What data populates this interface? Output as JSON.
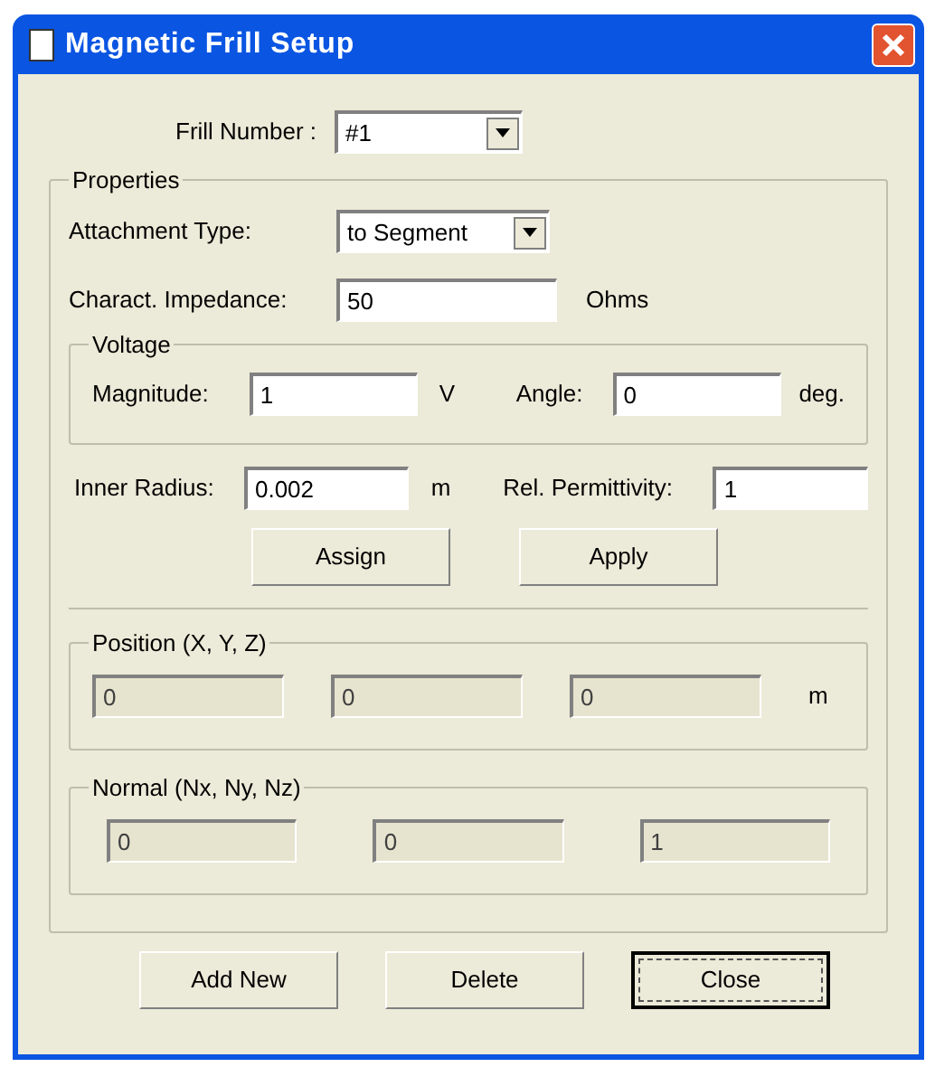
{
  "window": {
    "title": "Magnetic Frill Setup"
  },
  "frill_number": {
    "label": "Frill Number :",
    "value": "#1"
  },
  "properties": {
    "title": "Properties",
    "attachment_type": {
      "label": "Attachment Type:",
      "value": "to Segment"
    },
    "impedance": {
      "label": "Charact. Impedance:",
      "value": "50",
      "unit": "Ohms"
    },
    "voltage": {
      "title": "Voltage",
      "magnitude": {
        "label": "Magnitude:",
        "value": "1",
        "unit": "V"
      },
      "angle": {
        "label": "Angle:",
        "value": "0",
        "unit": "deg."
      }
    },
    "inner_radius": {
      "label": "Inner Radius:",
      "value": "0.002",
      "unit": "m"
    },
    "permittivity": {
      "label": "Rel. Permittivity:",
      "value": "1"
    },
    "buttons": [
      {
        "label": "Assign"
      },
      {
        "label": "Apply"
      }
    ],
    "position": {
      "title": "Position (X, Y, Z)",
      "disabled": true,
      "values": [
        "0",
        "0",
        "0"
      ],
      "unit": "m"
    },
    "normal": {
      "title": "Normal (Nx, Ny, Nz)",
      "disabled": true,
      "values": [
        "0",
        "0",
        "1"
      ]
    }
  },
  "buttons": [
    {
      "label": "Add New",
      "default": false
    },
    {
      "label": "Delete",
      "default": false
    },
    {
      "label": "Close",
      "default": true
    }
  ]
}
